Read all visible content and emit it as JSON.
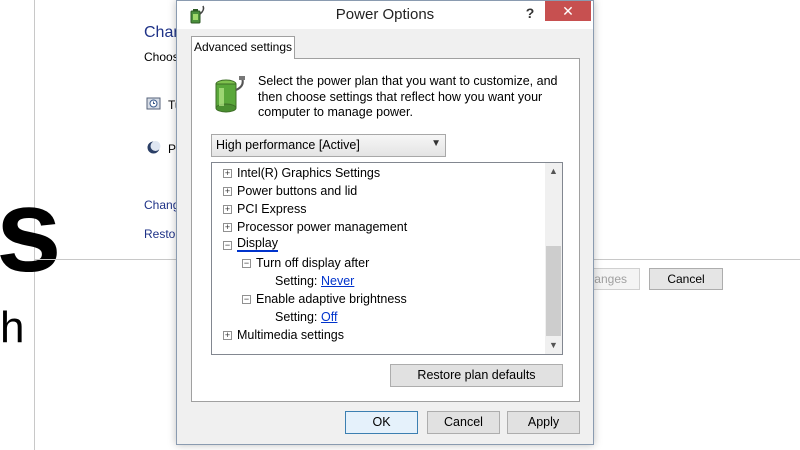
{
  "background": {
    "big_letter": "s",
    "small_letter": "h",
    "heading_fragment": "Chan",
    "subtext_fragment": "Choos",
    "item1_fragment": "Tu",
    "item2_fragment": "Pc",
    "link1_fragment": "Chang",
    "link2_fragment": "Restor",
    "save_changes_fragment": "anges",
    "cancel_label": "Cancel"
  },
  "dialog": {
    "title": "Power Options",
    "help_label": "?",
    "close_label": "✕",
    "tab_label": "Advanced settings",
    "intro_text": "Select the power plan that you want to customize, and then choose settings that reflect how you want your computer to manage power.",
    "plan_select": {
      "value": "High performance [Active]",
      "arrow": "▼"
    },
    "tree": {
      "items": [
        {
          "expander": "+",
          "label": "Intel(R) Graphics Settings"
        },
        {
          "expander": "+",
          "label": "Power buttons and lid"
        },
        {
          "expander": "+",
          "label": "PCI Express"
        },
        {
          "expander": "+",
          "label": "Processor power management"
        },
        {
          "expander": "−",
          "label": "Display"
        },
        {
          "expander": "−",
          "label": "Turn off display after"
        },
        {
          "setting_label": "Setting:",
          "value": "Never"
        },
        {
          "expander": "−",
          "label": "Enable adaptive brightness"
        },
        {
          "setting_label": "Setting:",
          "value": "Off"
        },
        {
          "expander": "+",
          "label": "Multimedia settings"
        }
      ]
    },
    "scroll_up": "▲",
    "scroll_down": "▼",
    "restore_button": "Restore plan defaults",
    "ok_button": "OK",
    "cancel_button": "Cancel",
    "apply_button": "Apply"
  },
  "colors": {
    "link": "#0033cc",
    "close_button": "#c75050",
    "heading": "#1e3287"
  }
}
